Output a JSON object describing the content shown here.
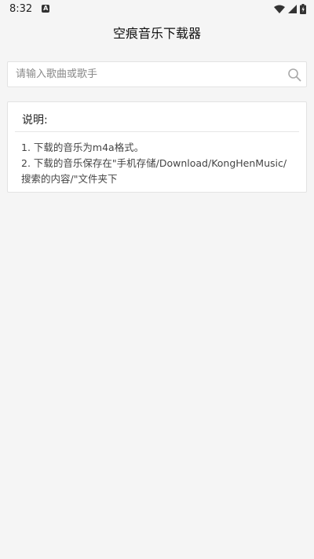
{
  "status_bar": {
    "time": "8:32",
    "notification_glyph": "A"
  },
  "app": {
    "title": "空痕音乐下载器"
  },
  "search": {
    "placeholder": "请输入歌曲或歌手",
    "value": ""
  },
  "info_card": {
    "title": "说明:",
    "lines": [
      "1. 下载的音乐为m4a格式。",
      "2. 下载的音乐保存在\"手机存储/Download/KongHenMusic/搜索的内容/\"文件夹下"
    ]
  },
  "colors": {
    "background": "#f5f5f5",
    "card": "#ffffff",
    "border": "#e3e3e3"
  }
}
